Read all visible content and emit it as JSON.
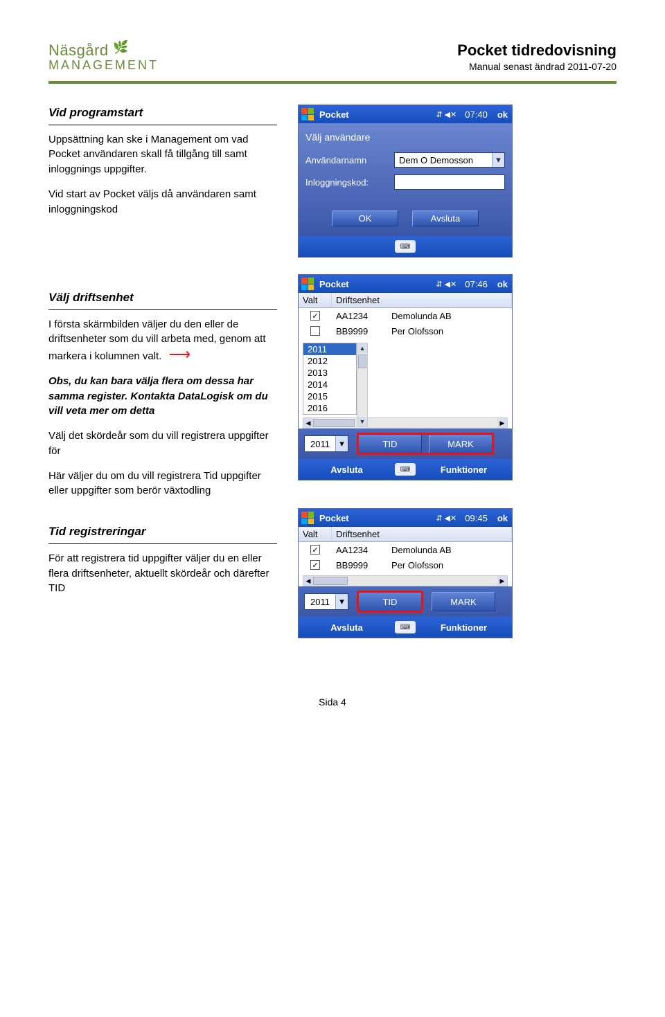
{
  "header": {
    "logo_top": "Näsgård",
    "logo_bottom": "MANAGEMENT",
    "doc_title": "Pocket tidredovisning",
    "doc_sub": "Manual senast ändrad 2011-07-20"
  },
  "sections": {
    "s1": {
      "heading": "Vid programstart",
      "p1": "Uppsättning kan ske i Management om vad Pocket användaren skall få tillgång till samt inloggnings uppgifter.",
      "p2": "Vid start av Pocket väljs då användaren samt inloggningskod"
    },
    "s2": {
      "heading": "Välj driftsenhet",
      "p1": "I första skärmbilden väljer du den eller de driftsenheter som du vill arbeta med, genom att markera i kolumnen valt.",
      "p2": "Obs, du kan bara välja flera om dessa har samma register. Kontakta DataLogisk om du vill veta mer om detta",
      "p3": "Välj det skördeår som du vill registrera uppgifter för",
      "p4": "Här väljer du om du vill registrera Tid uppgifter eller uppgifter som berör växtodling"
    },
    "s3": {
      "heading": "Tid registreringar",
      "p1": "För att registrera tid uppgifter väljer du en eller flera driftsenheter, aktuellt skördeår och därefter TID"
    }
  },
  "shot1": {
    "top": {
      "app": "Pocket",
      "time": "07:40",
      "ok": "ok",
      "signal": "⇵ ◀✕"
    },
    "heading": "Välj användare",
    "fields": {
      "user_label": "Användarnamn",
      "user_value": "Dem O Demosson",
      "code_label": "Inloggningskod:"
    },
    "buttons": {
      "ok": "OK",
      "quit": "Avsluta"
    }
  },
  "shot2": {
    "top": {
      "app": "Pocket",
      "time": "07:46",
      "ok": "ok"
    },
    "cols": {
      "valt": "Valt",
      "de": "Driftsenhet"
    },
    "rows": [
      {
        "checked": true,
        "code": "AA1234",
        "name": "Demolunda AB"
      },
      {
        "checked": false,
        "code": "BB9999",
        "name": "Per Olofsson"
      }
    ],
    "years": [
      "2011",
      "2012",
      "2013",
      "2014",
      "2015",
      "2016"
    ],
    "selected_year_list": "2011",
    "year_sel": "2011",
    "btn_tid": "TID",
    "btn_mark": "MARK",
    "bottom": {
      "left": "Avsluta",
      "right": "Funktioner"
    }
  },
  "shot3": {
    "top": {
      "app": "Pocket",
      "time": "09:45",
      "ok": "ok"
    },
    "cols": {
      "valt": "Valt",
      "de": "Driftsenhet"
    },
    "rows": [
      {
        "checked": true,
        "code": "AA1234",
        "name": "Demolunda AB"
      },
      {
        "checked": true,
        "code": "BB9999",
        "name": "Per Olofsson"
      }
    ],
    "year_sel": "2011",
    "btn_tid": "TID",
    "btn_mark": "MARK",
    "bottom": {
      "left": "Avsluta",
      "right": "Funktioner"
    }
  },
  "footer": "Sida 4"
}
